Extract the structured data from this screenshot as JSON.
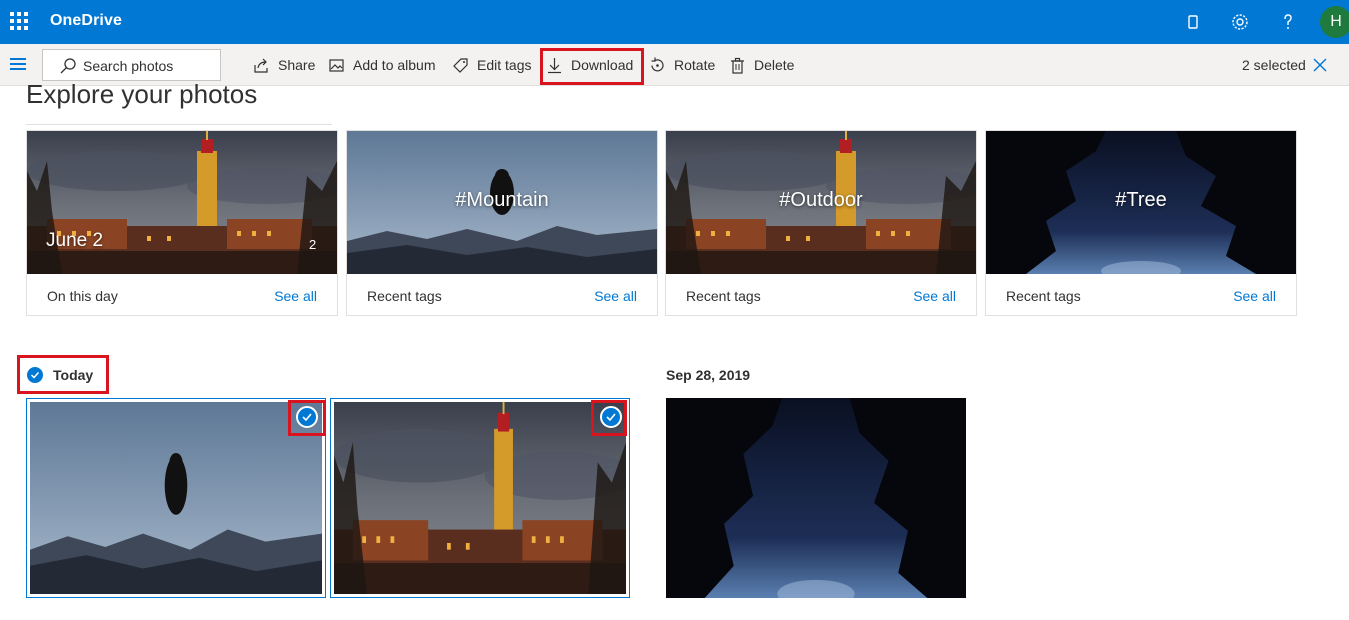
{
  "app": {
    "title": "OneDrive",
    "avatar_initial": "H"
  },
  "search": {
    "placeholder": "Search photos"
  },
  "commands": {
    "share": "Share",
    "add_to_album": "Add to album",
    "edit_tags": "Edit tags",
    "download": "Download",
    "rotate": "Rotate",
    "delete": "Delete",
    "selected_count": "2 selected"
  },
  "explore": {
    "title": "Explore your photos",
    "cards": [
      {
        "overlay": "June 2",
        "count": "2",
        "footer": "On this day",
        "link": "See all"
      },
      {
        "overlay": "#Mountain",
        "footer": "Recent tags",
        "link": "See all"
      },
      {
        "overlay": "#Outdoor",
        "footer": "Recent tags",
        "link": "See all"
      },
      {
        "overlay": "#Tree",
        "footer": "Recent tags",
        "link": "See all"
      }
    ]
  },
  "groups": [
    {
      "label": "Today",
      "selected": true
    },
    {
      "label": "Sep 28, 2019",
      "selected": false
    }
  ],
  "colors": {
    "brand": "#0078d4",
    "highlight": "#d9141e",
    "avatar": "#1f7a3d"
  }
}
